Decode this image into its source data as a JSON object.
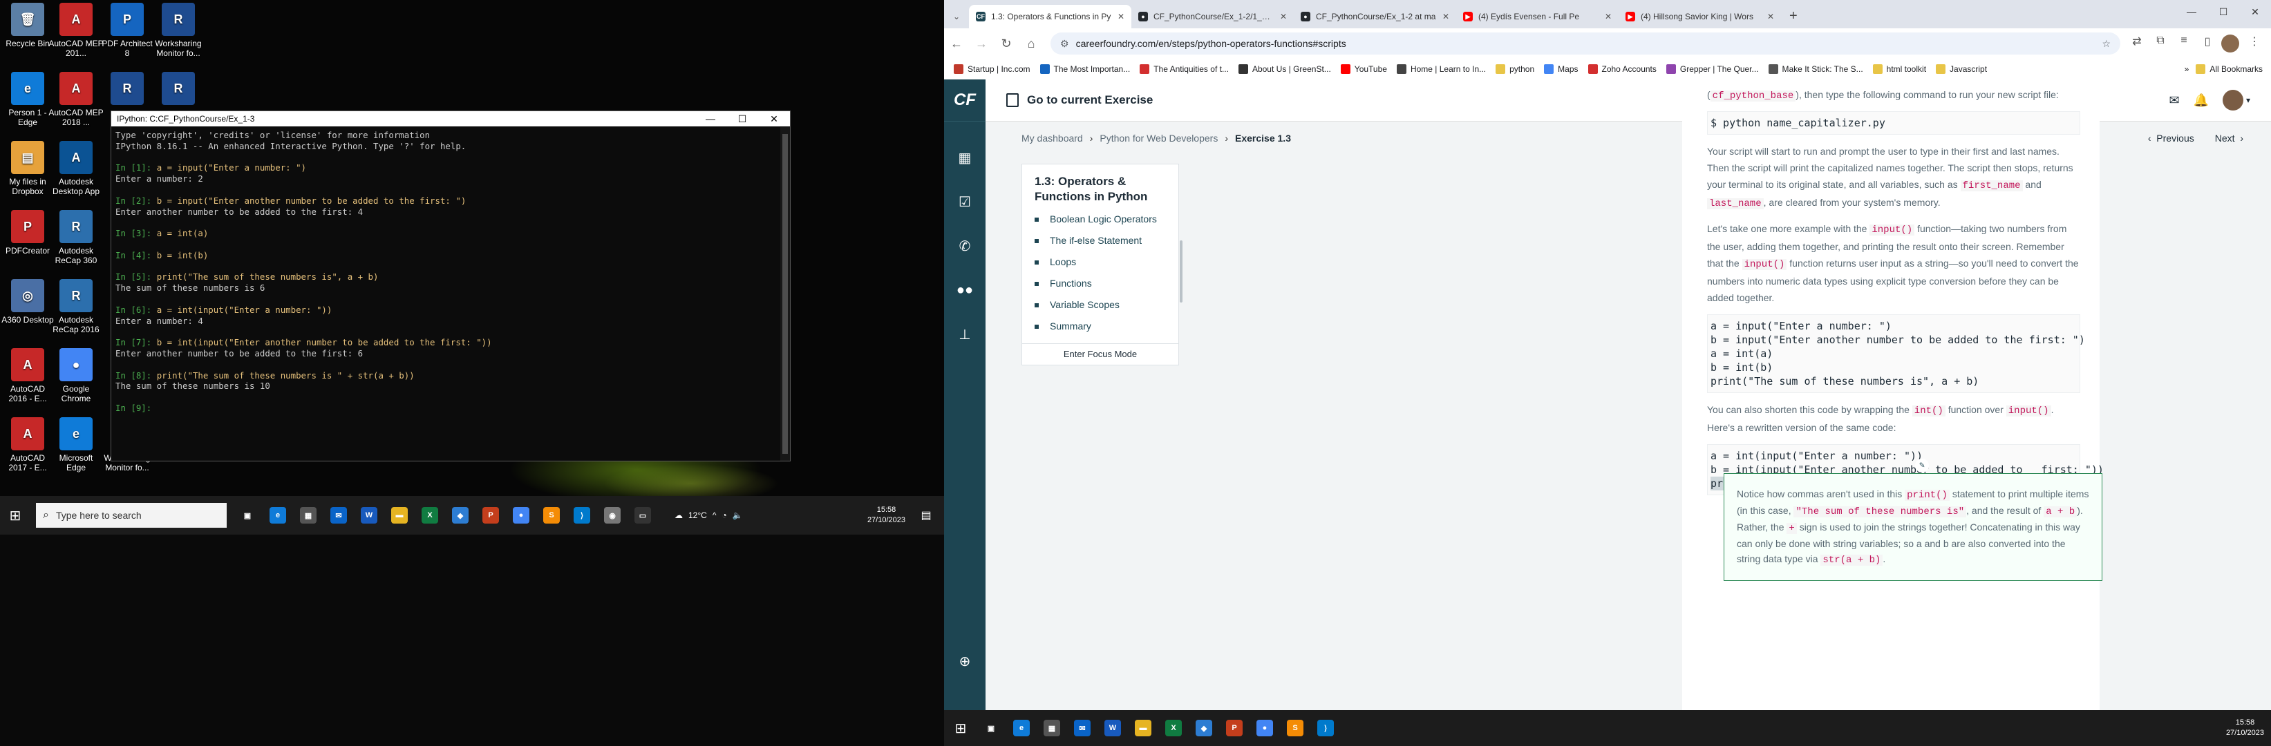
{
  "left_desktop": {
    "icons": [
      {
        "label": "Recycle Bin",
        "color": "#5b7fa6",
        "glyph": "🗑"
      },
      {
        "label": "AutoCAD MEP 201...",
        "color": "#c62828",
        "glyph": "A"
      },
      {
        "label": "PDF Architect 8",
        "color": "#1565c0",
        "glyph": "P"
      },
      {
        "label": "Worksharing Monitor fo...",
        "color": "#1e4b8f",
        "glyph": "R"
      },
      {
        "label": "Person 1 - Edge",
        "color": "#0f7bd8",
        "glyph": "e"
      },
      {
        "label": "AutoCAD MEP 2018 ...",
        "color": "#c62828",
        "glyph": "A"
      },
      {
        "label": "",
        "color": "#1e4b8f",
        "glyph": "R"
      },
      {
        "label": "",
        "color": "#1e4b8f",
        "glyph": "R"
      },
      {
        "label": "My files in Dropbox",
        "color": "#e6a23c",
        "glyph": "▤"
      },
      {
        "label": "Autodesk Desktop App",
        "color": "#0b5394",
        "glyph": "A"
      },
      {
        "label": "PDFCreator",
        "color": "#c62828",
        "glyph": "P"
      },
      {
        "label": "Autodesk ReCap 360",
        "color": "#2c6fad",
        "glyph": "R"
      },
      {
        "label": "A360 Desktop",
        "color": "#4a6fa5",
        "glyph": "◎"
      },
      {
        "label": "Autodesk ReCap 2016",
        "color": "#2c6fad",
        "glyph": "R"
      },
      {
        "label": "AutoCAD 2016 - E...",
        "color": "#c62828",
        "glyph": "A"
      },
      {
        "label": "Google Chrome",
        "color": "#4285f4",
        "glyph": "●"
      },
      {
        "label": "AutoCAD 2017 - E...",
        "color": "#c62828",
        "glyph": "A"
      },
      {
        "label": "Microsoft Edge",
        "color": "#0f7bd8",
        "glyph": "e"
      },
      {
        "label": "Worksharing Monitor fo...",
        "color": "#1e4b8f",
        "glyph": "R"
      }
    ],
    "ipython": {
      "title": "IPython: C:CF_PythonCourse/Ex_1-3",
      "controls": [
        "—",
        "☐",
        "✕"
      ],
      "lines": [
        {
          "t": "plain",
          "text": "Type 'copyright', 'credits' or 'license' for more information"
        },
        {
          "t": "plain",
          "text": "IPython 8.16.1 -- An enhanced Interactive Python. Type '?' for help."
        },
        {
          "t": "blank",
          "text": ""
        },
        {
          "t": "in",
          "prompt": "In [1]: ",
          "code": "a = input(\"Enter a number: \")"
        },
        {
          "t": "plain",
          "text": "Enter a number: 2"
        },
        {
          "t": "blank",
          "text": ""
        },
        {
          "t": "in",
          "prompt": "In [2]: ",
          "code": "b = input(\"Enter another number to be added to the first: \")"
        },
        {
          "t": "plain",
          "text": "Enter another number to be added to the first: 4"
        },
        {
          "t": "blank",
          "text": ""
        },
        {
          "t": "in",
          "prompt": "In [3]: ",
          "code": "a = int(a)"
        },
        {
          "t": "blank",
          "text": ""
        },
        {
          "t": "in",
          "prompt": "In [4]: ",
          "code": "b = int(b)"
        },
        {
          "t": "blank",
          "text": ""
        },
        {
          "t": "in",
          "prompt": "In [5]: ",
          "code": "print(\"The sum of these numbers is\", a + b)"
        },
        {
          "t": "plain",
          "text": "The sum of these numbers is 6"
        },
        {
          "t": "blank",
          "text": ""
        },
        {
          "t": "in",
          "prompt": "In [6]: ",
          "code": "a = int(input(\"Enter a number: \"))"
        },
        {
          "t": "plain",
          "text": "Enter a number: 4"
        },
        {
          "t": "blank",
          "text": ""
        },
        {
          "t": "in",
          "prompt": "In [7]: ",
          "code": "b = int(input(\"Enter another number to be added to the first: \"))"
        },
        {
          "t": "plain",
          "text": "Enter another number to be added to the first: 6"
        },
        {
          "t": "blank",
          "text": ""
        },
        {
          "t": "in",
          "prompt": "In [8]: ",
          "code": "print(\"The sum of these numbers is \" + str(a + b))"
        },
        {
          "t": "plain",
          "text": "The sum of these numbers is 10"
        },
        {
          "t": "blank",
          "text": ""
        },
        {
          "t": "in",
          "prompt": "In [9]: ",
          "code": ""
        }
      ]
    },
    "taskbar": {
      "search_placeholder": "Type here to search",
      "apps": [
        {
          "name": "task-view-icon",
          "glyph": "▣",
          "color": "#1c1c1c"
        },
        {
          "name": "edge-icon",
          "glyph": "e",
          "color": "#0f7bd8"
        },
        {
          "name": "store-icon",
          "glyph": "▦",
          "color": "#555"
        },
        {
          "name": "mail-icon",
          "glyph": "✉",
          "color": "#0a64c8"
        },
        {
          "name": "word-icon",
          "glyph": "W",
          "color": "#185abd"
        },
        {
          "name": "explorer-icon",
          "glyph": "▬",
          "color": "#e6b422"
        },
        {
          "name": "excel-icon",
          "glyph": "X",
          "color": "#107c41"
        },
        {
          "name": "app-icon",
          "glyph": "◆",
          "color": "#2d7dd2"
        },
        {
          "name": "powerpoint-icon",
          "glyph": "P",
          "color": "#c43e1c"
        },
        {
          "name": "chrome-icon",
          "glyph": "●",
          "color": "#4285f4"
        },
        {
          "name": "sublime-icon",
          "glyph": "S",
          "color": "#f48c06"
        },
        {
          "name": "vscode-icon",
          "glyph": "⟩",
          "color": "#007acc"
        },
        {
          "name": "python-icon",
          "glyph": "◉",
          "color": "#777"
        },
        {
          "name": "terminal-icon",
          "glyph": "▭",
          "color": "#333"
        }
      ],
      "weather": "12°C",
      "time": "15:58",
      "date": "27/10/2023"
    }
  },
  "browser": {
    "tabs": [
      {
        "title": "1.3: Operators & Functions in Py",
        "fav": "CF",
        "favcolor": "#1d4552",
        "active": true
      },
      {
        "title": "CF_PythonCourse/Ex_1-2/1_2-E",
        "fav": "●",
        "favcolor": "#24292e",
        "active": false
      },
      {
        "title": "CF_PythonCourse/Ex_1-2 at ma",
        "fav": "●",
        "favcolor": "#24292e",
        "active": false
      },
      {
        "title": "(4) Eydís Evensen - Full Pe",
        "fav": "▶",
        "favcolor": "#ff0000",
        "active": false
      },
      {
        "title": "(4) Hillsong Savior King | Wors",
        "fav": "▶",
        "favcolor": "#ff0000",
        "active": false
      }
    ],
    "url": "careerfoundry.com/en/steps/python-operators-functions#scripts",
    "bookmarks": [
      "Startup | Inc.com",
      "The Most Importan...",
      "The Antiquities of t...",
      "About Us | GreenSt...",
      "YouTube",
      "Home | Learn to In...",
      "python",
      "Maps",
      "Zoho Accounts",
      "Grepper | The Quer...",
      "Make It Stick: The S...",
      "html toolkit",
      "Javascript"
    ],
    "bookmarks_all": "All Bookmarks"
  },
  "page": {
    "logo": "CF",
    "goto": "Go to current Exercise",
    "breadcrumbs": [
      "My dashboard",
      "Python for Web Developers",
      "Exercise 1.3"
    ],
    "prev": "Previous",
    "next": "Next",
    "sidebar": {
      "title": "1.3: Operators & Functions in Python",
      "items": [
        "Boolean Logic Operators",
        "The if-else Statement",
        "Loops",
        "Functions",
        "Variable Scopes",
        "Summary"
      ],
      "focus": "Enter Focus Mode"
    },
    "content": {
      "p0a": "(",
      "p0code": "cf_python_base",
      "p0b": "), then type the following command to run your new script file:",
      "cmd": "$ python name_capitalizer.py",
      "p1a": "Your script will start to run and prompt the user to type in their first and last names. Then the script will print the capitalized names together. The script then stops, returns your terminal to its original state, and all variables, such as",
      "p1c1": "first_name",
      "p1b": "and",
      "p1c2": "last_name",
      "p1c": ", are cleared from your system's memory.",
      "p2a": "Let's take one more example with the",
      "p2c1": "input()",
      "p2b": "function—taking two numbers from the user, adding them together, and printing the result onto their screen. Remember that the",
      "p2c2": "input()",
      "p2c": "function returns user input as a string—so you'll need to convert the numbers into numeric data types using explicit type conversion before they can be added together.",
      "code1": [
        "a = input(\"Enter a number: \")",
        "b = input(\"Enter another number to be added to the first: \")",
        "a = int(a)",
        "b = int(b)",
        "print(\"The sum of these numbers is\", a + b)"
      ],
      "p3a": "You can also shorten this code by wrapping the",
      "p3c1": "int()",
      "p3b": "function over",
      "p3c2": "input()",
      "p3c": ". Here's a rewritten version of the same code:",
      "code2": [
        "a = int(input(\"Enter a number: \"))",
        "b = int(input(\"Enter another number to be added to   first: \"))",
        "print(\"The sum of these numbers is \" + str(a + b))"
      ],
      "note_a": "Notice how commas aren't used in this",
      "note_c1": "print()",
      "note_b": "statement to print multiple items (in this case,",
      "note_c2": "\"The sum of these numbers is\"",
      "note_c": ", and the result of",
      "note_c3": "a + b",
      "note_d": "). Rather, the",
      "note_c4": "+",
      "note_e": "sign is used to join the strings together! Concatenating in this way can only be done with string variables; so a and b are also converted into the string data type via",
      "note_c5": "str(a + b)",
      "note_f": "."
    }
  },
  "right_taskbar": {
    "time": "15:58",
    "date": "27/10/2023"
  }
}
